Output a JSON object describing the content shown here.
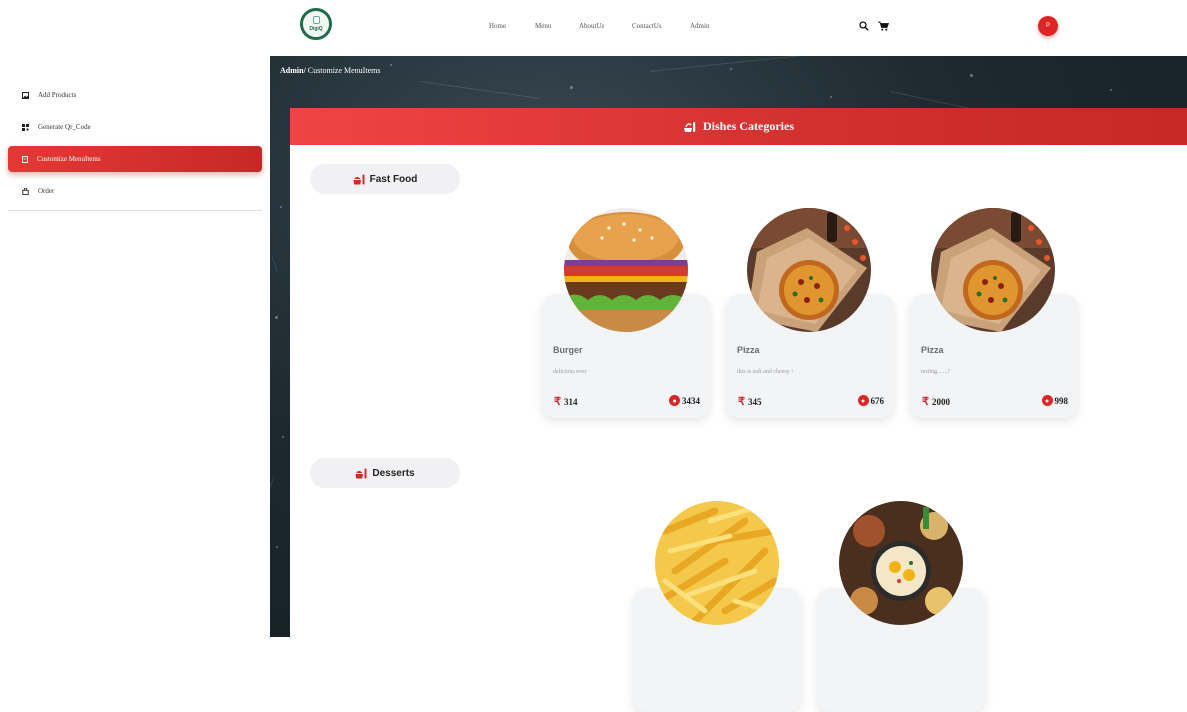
{
  "brand": {
    "logo_text": "DigiQ"
  },
  "nav": {
    "links": [
      "Home",
      "Menu",
      "AboutUs",
      "ContactUs",
      "Admin"
    ],
    "avatar_letter": "P"
  },
  "sidebar": {
    "items": [
      {
        "label": "Add Products",
        "icon": "image-icon",
        "active": false
      },
      {
        "label": "Generate Qr_Code",
        "icon": "qr-code-icon",
        "active": false
      },
      {
        "label": "Customize MenuItems",
        "icon": "document-icon",
        "active": true
      },
      {
        "label": "Order",
        "icon": "bag-icon",
        "active": false
      }
    ]
  },
  "breadcrumb": {
    "root": "Admin/",
    "current": " Customize MenuItems"
  },
  "panel": {
    "title": "Dishes Categories"
  },
  "categories": [
    {
      "name": "Fast Food",
      "items": [
        {
          "title": "Burger",
          "description": "delicious ever",
          "price": "314",
          "stock": "3434",
          "image": "burger"
        },
        {
          "title": "Pizza",
          "description": "this is soft and cheesy !",
          "price": "345",
          "stock": "676",
          "image": "pizza"
        },
        {
          "title": "Pizza",
          "description": "testing.......?",
          "price": "2000",
          "stock": "998",
          "image": "pizza"
        }
      ]
    },
    {
      "name": "Desserts",
      "items": [
        {
          "image": "fries"
        },
        {
          "image": "breakfast"
        }
      ]
    }
  ],
  "colors": {
    "accent": "#dc2626",
    "header_start": "#ef4444",
    "header_end": "#c62828",
    "card_bg": "#f3f4f6"
  },
  "currency_symbol": "₹"
}
